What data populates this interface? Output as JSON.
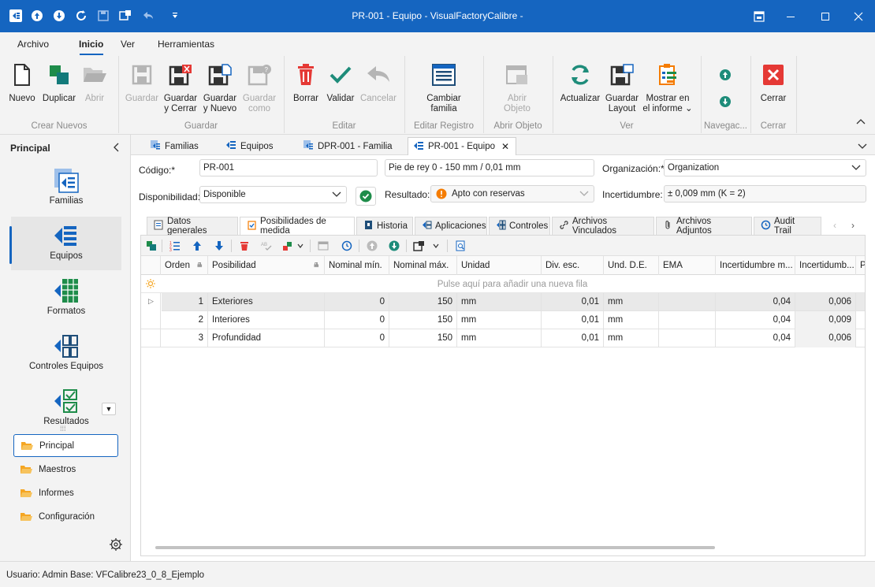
{
  "window": {
    "title": "PR-001 - Equipo - VisualFactoryCalibre -"
  },
  "colors": {
    "accent": "#1565c0",
    "green": "#1e8c4a",
    "red": "#e53935",
    "orange": "#f57c00"
  },
  "menu": {
    "items": [
      "Archivo",
      "Inicio",
      "Ver",
      "Herramientas"
    ],
    "active": "Inicio"
  },
  "ribbon": {
    "groups": {
      "crear_nuevos": "Crear Nuevos",
      "guardar": "Guardar",
      "editar": "Editar",
      "editar_registro": "Editar Registro",
      "abrir_objeto": "Abrir Objeto",
      "ver": "Ver",
      "navegacion": "Navegac...",
      "cerrar": "Cerrar"
    },
    "buttons": {
      "nuevo": "Nuevo",
      "duplicar": "Duplicar",
      "abrir": "Abrir",
      "guardar": "Guardar",
      "guardar_cerrar_1": "Guardar",
      "guardar_cerrar_2": "y Cerrar",
      "guardar_nuevo_1": "Guardar",
      "guardar_nuevo_2": "y Nuevo",
      "guardar_como_1": "Guardar",
      "guardar_como_2": "como",
      "borrar": "Borrar",
      "validar": "Validar",
      "cancelar": "Cancelar",
      "cambiar_familia_1": "Cambiar",
      "cambiar_familia_2": "familia",
      "abrir_objeto_1": "Abrir",
      "abrir_objeto_2": "Objeto",
      "actualizar": "Actualizar",
      "guardar_layout_1": "Guardar",
      "guardar_layout_2": "Layout",
      "mostrar_informe_1": "Mostrar en",
      "mostrar_informe_2": "el informe",
      "cerrar": "Cerrar"
    }
  },
  "leftnav": {
    "title": "Principal",
    "modules": [
      "Familias",
      "Equipos",
      "Formatos",
      "Controles Equipos",
      "Resultados"
    ],
    "active_module": "Equipos",
    "groups": [
      "Principal",
      "Maestros",
      "Informes",
      "Configuración"
    ],
    "active_group": "Principal"
  },
  "doctabs": [
    "Familias",
    "Equipos",
    "DPR-001 - Familia",
    "PR-001 - Equipo"
  ],
  "form": {
    "codigo_label": "Código:*",
    "codigo_value": "PR-001",
    "descripcion_value": "Pie de rey 0 - 150 mm / 0,01 mm",
    "organizacion_label": "Organización:*",
    "organizacion_value": "Organization",
    "disponibilidad_label": "Disponibilidad:",
    "disponibilidad_value": "Disponible",
    "resultado_label": "Resultado:",
    "resultado_value": "Apto con reservas",
    "incertidumbre_label": "Incertidumbre:",
    "incertidumbre_value": "± 0,009 mm (K = 2)"
  },
  "innertabs": [
    "Datos generales",
    "Posibilidades de medida",
    "Historia",
    "Aplicaciones",
    "Controles",
    "Archivos Vinculados",
    "Archivos Adjuntos",
    "Audit Trail"
  ],
  "active_innertab": "Posibilidades de medida",
  "grid": {
    "columns": [
      "Orden",
      "Posibilidad",
      "Nominal mín.",
      "Nominal máx.",
      "Unidad",
      "Div. esc.",
      "Und. D.E.",
      "EMA",
      "Incertidumbre m...",
      "Incertidumb...",
      "Pe"
    ],
    "new_row_text": "Pulse aquí para añadir una nueva fila",
    "rows": [
      [
        "1",
        "Exteriores",
        "0",
        "150",
        "mm",
        "0,01",
        "mm",
        "",
        "0,04",
        "0,006"
      ],
      [
        "2",
        "Interiores",
        "0",
        "150",
        "mm",
        "0,01",
        "mm",
        "",
        "0,04",
        "0,009"
      ],
      [
        "3",
        "Profundidad",
        "0",
        "150",
        "mm",
        "0,01",
        "mm",
        "",
        "0,04",
        "0,006"
      ]
    ]
  },
  "status": {
    "usuario": "Usuario: Admin",
    "base": "Base: VFCalibre23_0_8_Ejemplo"
  }
}
